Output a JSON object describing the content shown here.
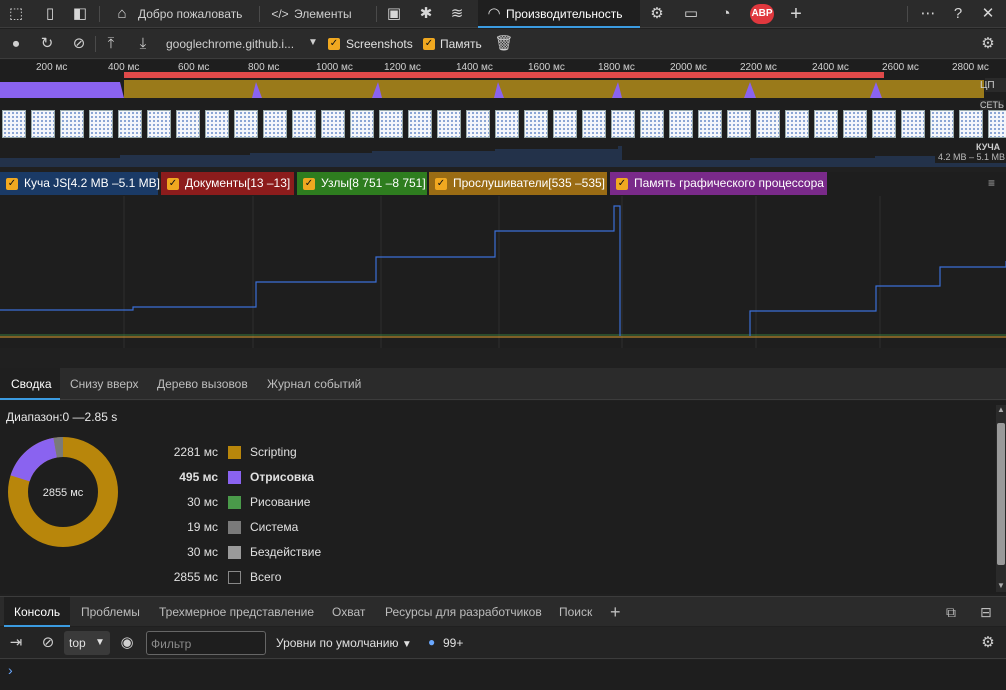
{
  "tabs": {
    "welcome": "Добро пожаловать",
    "elements": "Элементы",
    "performance": "Производительность",
    "abp": "ABP"
  },
  "perf_toolbar": {
    "url": "googlechrome.github.i...",
    "screenshots": "Screenshots",
    "memory": "Память"
  },
  "overview": {
    "ticks": [
      "200 мс",
      "400 мс",
      "600 мс",
      "800 мс",
      "1000 мс",
      "1200 мс",
      "1400 мс",
      "1600 мс",
      "1800 мс",
      "2000 мс",
      "2200 мс",
      "2400 мс",
      "2600 мс",
      "2800 мс"
    ],
    "cpu_label": "ЦП",
    "net_label": "СЕТЬ",
    "heap_label": "КУЧА",
    "heap_range": "4.2 МВ – 5.1 МВ"
  },
  "counters": [
    {
      "name": "js-heap",
      "label": "Куча JS[4.2 MB –5.1 MB]",
      "color": "#1a3a66"
    },
    {
      "name": "documents",
      "label": "Документы[13 –13]",
      "color": "#8c1c1c"
    },
    {
      "name": "nodes",
      "label": "Узлы[8 751 –8 751]",
      "color": "#2e7d1f"
    },
    {
      "name": "listeners",
      "label": "Прослушиватели[535 –535]",
      "color": "#9a6c14"
    },
    {
      "name": "gpu",
      "label": "Память графического процессора",
      "color": "#7a2a8a"
    }
  ],
  "bottom_tabs": [
    "Сводка",
    "Снизу вверх",
    "Дерево вызовов",
    "Журнал событий"
  ],
  "summary": {
    "range": "Диапазон:0 —2.85 s",
    "total_center": "2855 мс",
    "rows": [
      {
        "ms": "2281 мс",
        "label": "Scripting",
        "color": "#b8860b",
        "bold": false
      },
      {
        "ms": "495 мс",
        "label": "Отрисовка",
        "color": "#8a63f0",
        "bold": true
      },
      {
        "ms": "30 мс",
        "label": "Рисование",
        "color": "#4a9a4a",
        "bold": false
      },
      {
        "ms": "19 мс",
        "label": "Система",
        "color": "#7a7a7a",
        "bold": false
      },
      {
        "ms": "30 мс",
        "label": "Бездействие",
        "color": "#9a9a9a",
        "bold": false
      },
      {
        "ms": "2855 мс",
        "label": "Всего",
        "color": "#1e1e1e",
        "bold": false
      }
    ],
    "donut_values": [
      2281,
      495,
      30,
      19,
      30
    ]
  },
  "drawer_tabs": [
    "Консоль",
    "Проблемы",
    "Трехмерное представление",
    "Охват",
    "Ресурсы для разработчиков",
    "Поиск"
  ],
  "console": {
    "context": "top",
    "filter_placeholder": "Фильтр",
    "levels": "Уровни по умолчанию",
    "issues": "99+"
  }
}
